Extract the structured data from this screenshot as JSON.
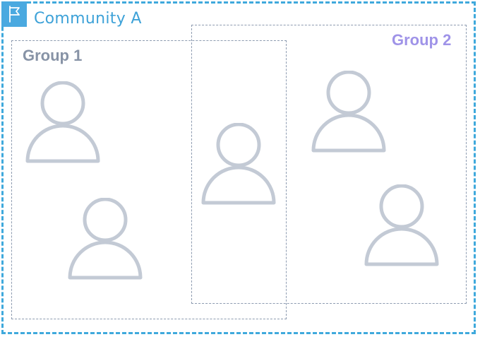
{
  "community": {
    "title": "Community A",
    "icon": "flag-icon",
    "color": "#3fa9dc"
  },
  "groups": [
    {
      "label": "Group 1",
      "color": "#8793a6"
    },
    {
      "label": "Group 2",
      "color": "#9f93e8"
    }
  ],
  "members": [
    {
      "icon": "person-icon",
      "group": "Group 1"
    },
    {
      "icon": "person-icon",
      "group": "Group 1"
    },
    {
      "icon": "person-icon",
      "group": "Group 1 & Group 2"
    },
    {
      "icon": "person-icon",
      "group": "Group 2"
    },
    {
      "icon": "person-icon",
      "group": "Group 2"
    }
  ],
  "person_color": "#c3cad5"
}
